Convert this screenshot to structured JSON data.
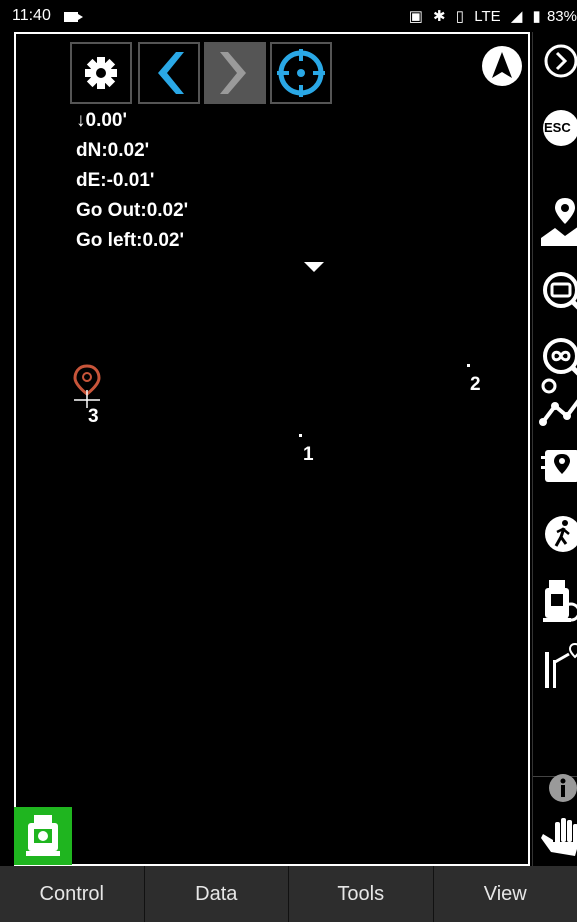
{
  "status_bar": {
    "time": "11:40",
    "network": "LTE",
    "battery": "83%",
    "icons": [
      "video-record-icon",
      "cast-icon",
      "bluetooth-icon",
      "vibrate-icon",
      "signal-icon",
      "battery-icon"
    ]
  },
  "toolbar": {
    "buttons": [
      {
        "icon": "gear-icon"
      },
      {
        "icon": "chevron-left-icon"
      },
      {
        "icon": "chevron-right-icon"
      },
      {
        "icon": "target-icon"
      }
    ]
  },
  "compass": {
    "icon": "navigation-arrow-icon"
  },
  "readouts": {
    "elevation": "↓0.00'",
    "dn": "dN:0.02'",
    "de": "dE:-0.01'",
    "go_out": "Go Out:0.02'",
    "go_left": "Go left:0.02'"
  },
  "points": [
    {
      "label": "1"
    },
    {
      "label": "2"
    },
    {
      "label": "3"
    }
  ],
  "sidebar": {
    "esc_label": "ESC",
    "items": [
      "chevron-circle-right-icon",
      "esc-icon",
      "map-pin-icon",
      "zoom-extent-icon",
      "zoom-all-icon",
      "route-icon",
      "point-book-icon",
      "walk-icon",
      "instrument-icon",
      "stakeout-icon",
      "info-icon",
      "hand-icon"
    ]
  },
  "station_button": {
    "icon": "total-station-icon"
  },
  "tabs": [
    "Control",
    "Data",
    "Tools",
    "View"
  ],
  "colors": {
    "accent_blue": "#2aa8e6",
    "station_green": "#1fb51f",
    "tab_bar": "#2d2d2d",
    "pin_orange": "#c8553a"
  }
}
